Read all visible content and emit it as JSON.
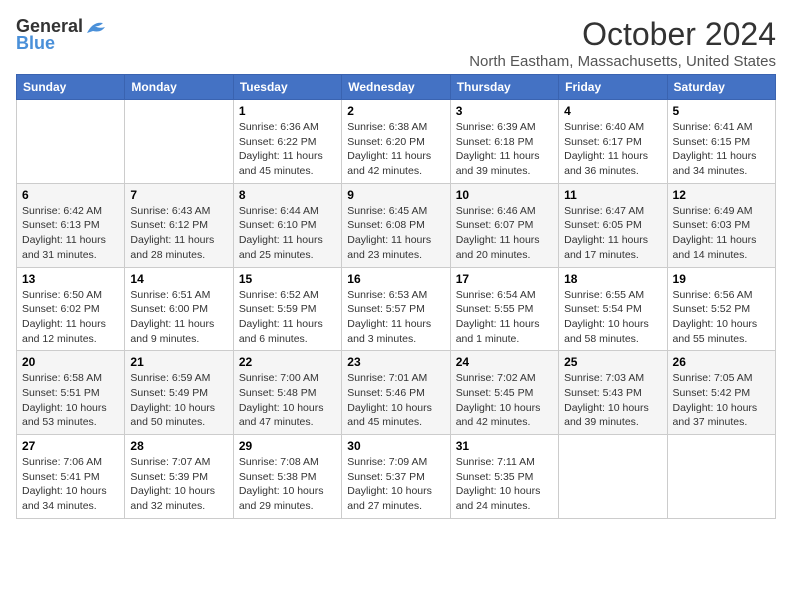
{
  "logo": {
    "line1": "General",
    "line2": "Blue"
  },
  "title": "October 2024",
  "location": "North Eastham, Massachusetts, United States",
  "days_of_week": [
    "Sunday",
    "Monday",
    "Tuesday",
    "Wednesday",
    "Thursday",
    "Friday",
    "Saturday"
  ],
  "weeks": [
    [
      {
        "day": "",
        "content": ""
      },
      {
        "day": "",
        "content": ""
      },
      {
        "day": "1",
        "sunrise": "6:36 AM",
        "sunset": "6:22 PM",
        "daylight": "11 hours and 45 minutes."
      },
      {
        "day": "2",
        "sunrise": "6:38 AM",
        "sunset": "6:20 PM",
        "daylight": "11 hours and 42 minutes."
      },
      {
        "day": "3",
        "sunrise": "6:39 AM",
        "sunset": "6:18 PM",
        "daylight": "11 hours and 39 minutes."
      },
      {
        "day": "4",
        "sunrise": "6:40 AM",
        "sunset": "6:17 PM",
        "daylight": "11 hours and 36 minutes."
      },
      {
        "day": "5",
        "sunrise": "6:41 AM",
        "sunset": "6:15 PM",
        "daylight": "11 hours and 34 minutes."
      }
    ],
    [
      {
        "day": "6",
        "sunrise": "6:42 AM",
        "sunset": "6:13 PM",
        "daylight": "11 hours and 31 minutes."
      },
      {
        "day": "7",
        "sunrise": "6:43 AM",
        "sunset": "6:12 PM",
        "daylight": "11 hours and 28 minutes."
      },
      {
        "day": "8",
        "sunrise": "6:44 AM",
        "sunset": "6:10 PM",
        "daylight": "11 hours and 25 minutes."
      },
      {
        "day": "9",
        "sunrise": "6:45 AM",
        "sunset": "6:08 PM",
        "daylight": "11 hours and 23 minutes."
      },
      {
        "day": "10",
        "sunrise": "6:46 AM",
        "sunset": "6:07 PM",
        "daylight": "11 hours and 20 minutes."
      },
      {
        "day": "11",
        "sunrise": "6:47 AM",
        "sunset": "6:05 PM",
        "daylight": "11 hours and 17 minutes."
      },
      {
        "day": "12",
        "sunrise": "6:49 AM",
        "sunset": "6:03 PM",
        "daylight": "11 hours and 14 minutes."
      }
    ],
    [
      {
        "day": "13",
        "sunrise": "6:50 AM",
        "sunset": "6:02 PM",
        "daylight": "11 hours and 12 minutes."
      },
      {
        "day": "14",
        "sunrise": "6:51 AM",
        "sunset": "6:00 PM",
        "daylight": "11 hours and 9 minutes."
      },
      {
        "day": "15",
        "sunrise": "6:52 AM",
        "sunset": "5:59 PM",
        "daylight": "11 hours and 6 minutes."
      },
      {
        "day": "16",
        "sunrise": "6:53 AM",
        "sunset": "5:57 PM",
        "daylight": "11 hours and 3 minutes."
      },
      {
        "day": "17",
        "sunrise": "6:54 AM",
        "sunset": "5:55 PM",
        "daylight": "11 hours and 1 minute."
      },
      {
        "day": "18",
        "sunrise": "6:55 AM",
        "sunset": "5:54 PM",
        "daylight": "10 hours and 58 minutes."
      },
      {
        "day": "19",
        "sunrise": "6:56 AM",
        "sunset": "5:52 PM",
        "daylight": "10 hours and 55 minutes."
      }
    ],
    [
      {
        "day": "20",
        "sunrise": "6:58 AM",
        "sunset": "5:51 PM",
        "daylight": "10 hours and 53 minutes."
      },
      {
        "day": "21",
        "sunrise": "6:59 AM",
        "sunset": "5:49 PM",
        "daylight": "10 hours and 50 minutes."
      },
      {
        "day": "22",
        "sunrise": "7:00 AM",
        "sunset": "5:48 PM",
        "daylight": "10 hours and 47 minutes."
      },
      {
        "day": "23",
        "sunrise": "7:01 AM",
        "sunset": "5:46 PM",
        "daylight": "10 hours and 45 minutes."
      },
      {
        "day": "24",
        "sunrise": "7:02 AM",
        "sunset": "5:45 PM",
        "daylight": "10 hours and 42 minutes."
      },
      {
        "day": "25",
        "sunrise": "7:03 AM",
        "sunset": "5:43 PM",
        "daylight": "10 hours and 39 minutes."
      },
      {
        "day": "26",
        "sunrise": "7:05 AM",
        "sunset": "5:42 PM",
        "daylight": "10 hours and 37 minutes."
      }
    ],
    [
      {
        "day": "27",
        "sunrise": "7:06 AM",
        "sunset": "5:41 PM",
        "daylight": "10 hours and 34 minutes."
      },
      {
        "day": "28",
        "sunrise": "7:07 AM",
        "sunset": "5:39 PM",
        "daylight": "10 hours and 32 minutes."
      },
      {
        "day": "29",
        "sunrise": "7:08 AM",
        "sunset": "5:38 PM",
        "daylight": "10 hours and 29 minutes."
      },
      {
        "day": "30",
        "sunrise": "7:09 AM",
        "sunset": "5:37 PM",
        "daylight": "10 hours and 27 minutes."
      },
      {
        "day": "31",
        "sunrise": "7:11 AM",
        "sunset": "5:35 PM",
        "daylight": "10 hours and 24 minutes."
      },
      {
        "day": "",
        "content": ""
      },
      {
        "day": "",
        "content": ""
      }
    ]
  ],
  "labels": {
    "sunrise": "Sunrise:",
    "sunset": "Sunset:",
    "daylight": "Daylight:"
  }
}
